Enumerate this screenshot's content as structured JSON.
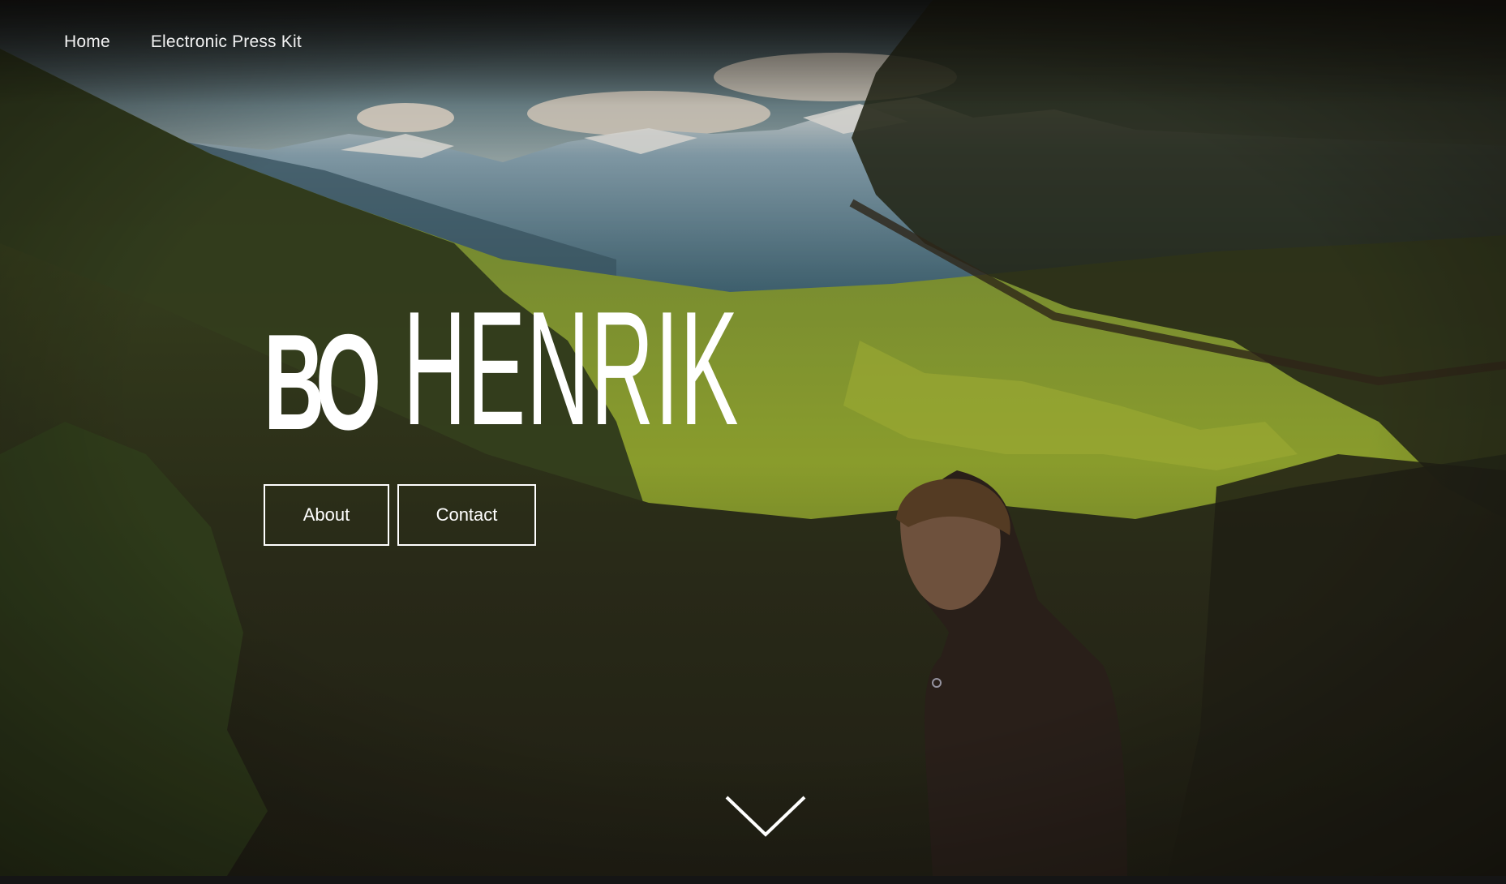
{
  "nav": {
    "items": [
      {
        "label": "Home"
      },
      {
        "label": "Electronic Press Kit"
      }
    ]
  },
  "hero": {
    "logo_part1": "BO",
    "logo_part2": "HENRIK",
    "buttons": {
      "about_label": "About",
      "contact_label": "Contact"
    },
    "scroll_icon": "chevron-down-icon"
  },
  "colors": {
    "text": "#ffffff",
    "button_border": "#ffffff",
    "sky": "#b9cdd2",
    "forest_dark": "#1f2414",
    "forest_light": "#8fae2c",
    "lake": "#4fa6c4"
  }
}
